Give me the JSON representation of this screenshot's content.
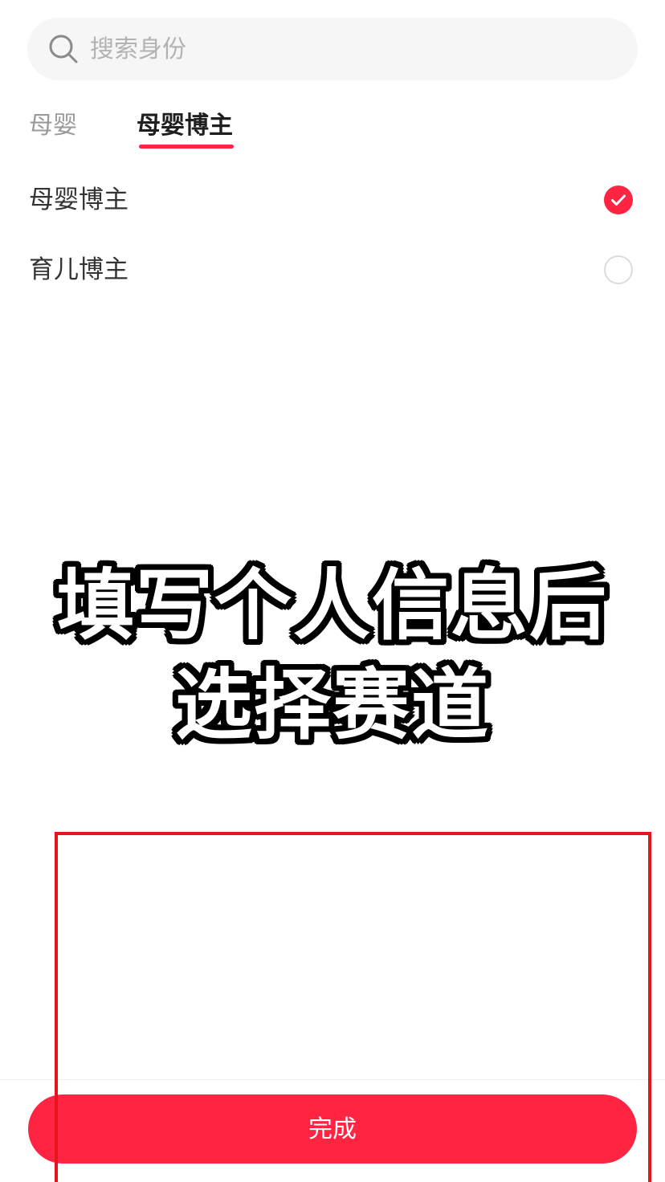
{
  "search": {
    "placeholder": "搜索身份",
    "value": ""
  },
  "tabs": [
    {
      "label": "母婴",
      "active": false
    },
    {
      "label": "母婴博主",
      "active": true
    }
  ],
  "options": [
    {
      "label": "母婴博主",
      "selected": true
    },
    {
      "label": "育儿博主",
      "selected": false
    }
  ],
  "caption": {
    "line1": "填写个人信息后",
    "line2": "选择赛道"
  },
  "footer": {
    "done_label": "完成"
  },
  "colors": {
    "accent": "#ff2442",
    "highlight": "#e8141d"
  }
}
